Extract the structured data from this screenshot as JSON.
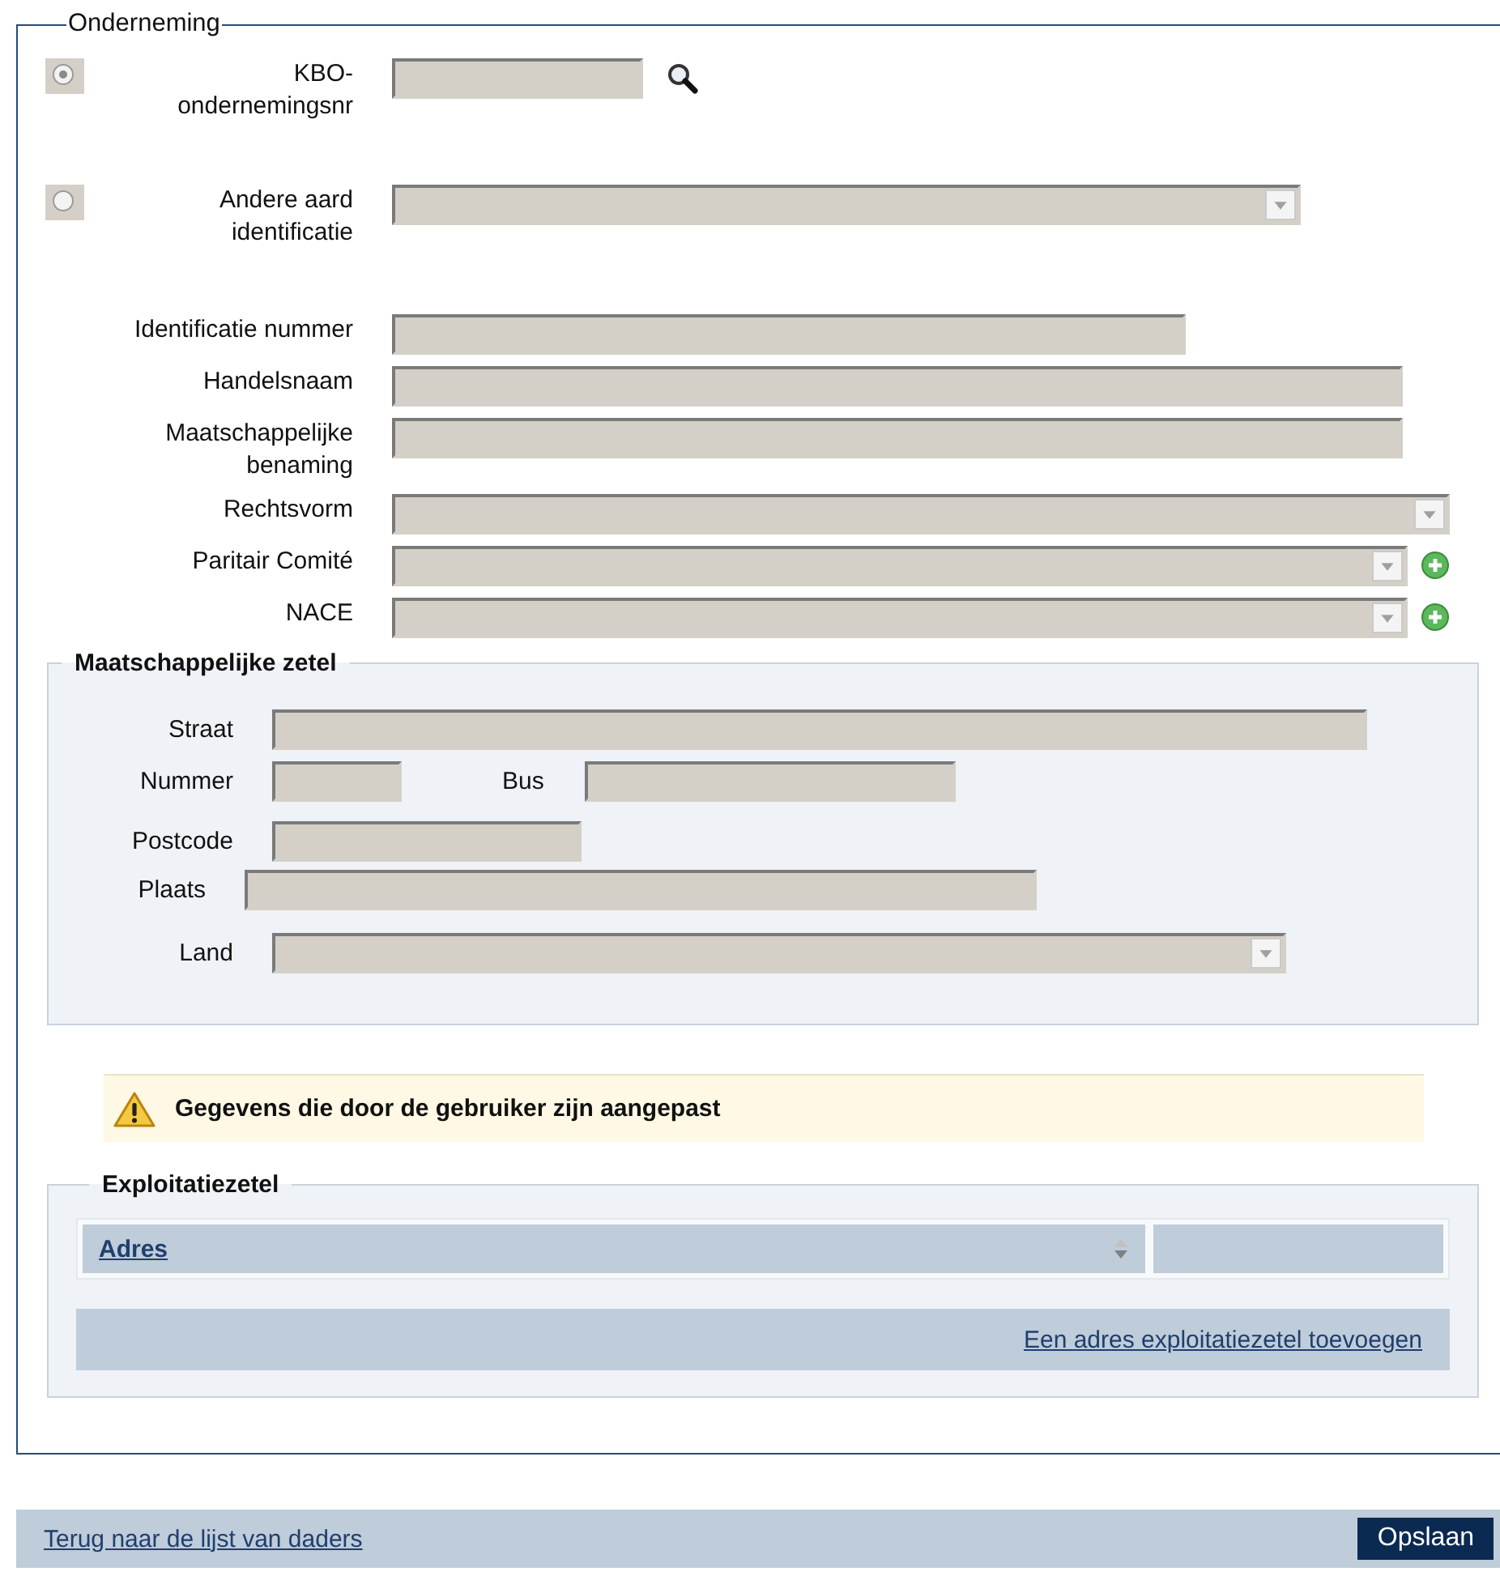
{
  "onderneming": {
    "legend": "Onderneming",
    "rows": [
      {
        "kind": "radio-text",
        "selected": true,
        "label": "KBO-ondernemingsnr",
        "search_button": true
      },
      {
        "kind": "radio-select",
        "selected": false,
        "label": "Andere aard identificatie"
      },
      {
        "kind": "text",
        "label": "Identificatie nummer"
      },
      {
        "kind": "text",
        "label": "Handelsnaam"
      },
      {
        "kind": "text",
        "label": "Maatschappelijke benaming"
      },
      {
        "kind": "select",
        "label": "Rechtsvorm"
      },
      {
        "kind": "select",
        "label": "Paritair Comité",
        "add_button": true
      },
      {
        "kind": "select",
        "label": "NACE",
        "add_button": true
      }
    ]
  },
  "maatschappelijke_zetel": {
    "legend": "Maatschappelijke zetel",
    "fields": [
      {
        "kind": "text",
        "label": "Straat"
      },
      {
        "kind": "text",
        "label": "Nummer"
      },
      {
        "kind": "text",
        "label": "Bus"
      },
      {
        "kind": "text",
        "label": "Postcode"
      },
      {
        "kind": "text",
        "label": "Plaats"
      },
      {
        "kind": "select",
        "label": "Land"
      }
    ]
  },
  "warning": {
    "text": "Gegevens die door de gebruiker zijn aangepast"
  },
  "exploitatiezetel": {
    "legend": "Exploitatiezetel",
    "table": {
      "columns": [
        {
          "label": "Adres",
          "sortable": true
        }
      ]
    },
    "add_link": "Een adres exploitatiezetel toevoegen"
  },
  "footer": {
    "back_link": "Terug naar de lijst van daders",
    "save_button": "Opslaan"
  }
}
